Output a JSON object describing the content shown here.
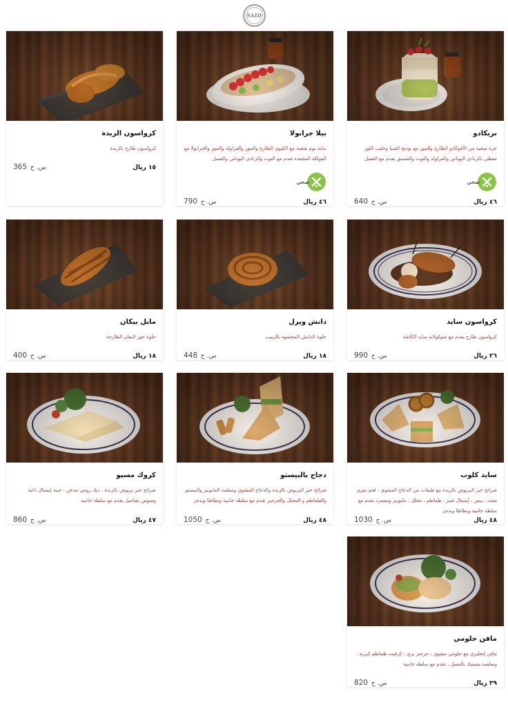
{
  "brand": {
    "logo_text": "SAID"
  },
  "currency": "ريال",
  "calorie_unit": "س. ح",
  "healthy_label": "صحي",
  "items": [
    {
      "id": "croissant-butter",
      "name": "كرواسون الزبدة",
      "description": "كرواسون طازج بالزبدة",
      "price": "١٥",
      "calories": "365",
      "healthy": false
    },
    {
      "id": "bella-granola",
      "name": "بيلا جرانولا",
      "description": "بداية يوم صحية مع الكيوي الطازج والموز والفراولة والموز والجرانولا مع الفولكة المجعدة تقدم مع التوت والزبادي اليوناني والعسل",
      "price": "٤٦",
      "calories": "790",
      "healthy": true
    },
    {
      "id": "bricado",
      "name": "بريكادو",
      "description": "جرة صحية من الأفوكادو الطازج والموز مع بودنج الشيا وحليب اللوز مغطى بالزبادي اليوناني والفراولة والتوت والفستق يقدم مع العسل",
      "price": "٤٦",
      "calories": "640",
      "healthy": true
    },
    {
      "id": "maple-pecan",
      "name": "مابل بيكان",
      "description": "حلوة جوز البقان الطازجة",
      "price": "١٨",
      "calories": "400",
      "healthy": false
    },
    {
      "id": "danish-swirl",
      "name": "دانش ويرل",
      "description": "حلوة الدانش المحشوة بالزبيب",
      "price": "١٨",
      "calories": "448",
      "healthy": false
    },
    {
      "id": "croissant-said",
      "name": "كرواسون سايد",
      "description": "كرواسون طازج يقدم مع شوكولاتة سايد الكاشة",
      "price": "٢٦",
      "calories": "990",
      "healthy": false
    },
    {
      "id": "croque-monsieur",
      "name": "كروك مسيو",
      "description": "شرائح خبز بريوش بالزبدة ، ديك رومي مدخن ، جبنة إيمنتال ذائبة وصوص بشاميل يقدم مع سلطة جانبية",
      "price": "٤٧",
      "calories": "860",
      "healthy": false
    },
    {
      "id": "chicken-pesto",
      "name": "دجاج بالبيستو",
      "description": "شرائح خبز البريوش بالزبدة والدجاج المشوي وصلصة المايونيز والبيستو والطماطم و المخلل والجرجير تقدم مع سلطة جانبية وبطاطا ويدجز",
      "price": "٤٨",
      "calories": "1050",
      "healthy": false
    },
    {
      "id": "said-club",
      "name": "سايد كلوب",
      "description": "شرائح خبز البريوش بالزبدة مع طبقات من الدجاج المشوي ، لحم بقري مقدد ، بيض ، إيمنتال شيز ، طماطم ، مخلل ، مايونيز ومسترد يقدم مع سلطة جانبية وبطاطا ويدجز",
      "price": "٤٨",
      "calories": "1030",
      "healthy": false
    },
    {
      "id": "halloumi-muffin",
      "name": "مافن حلومي",
      "description": "مافن إنجليزي مع حلومي مشوي ، جرجير بري ، كرفيت طماطم كرزية ، وصلصة بشميك بالعسل ، تقدم مع سلطة جانبية",
      "price": "٣٩",
      "calories": "820",
      "healthy": false
    }
  ]
}
